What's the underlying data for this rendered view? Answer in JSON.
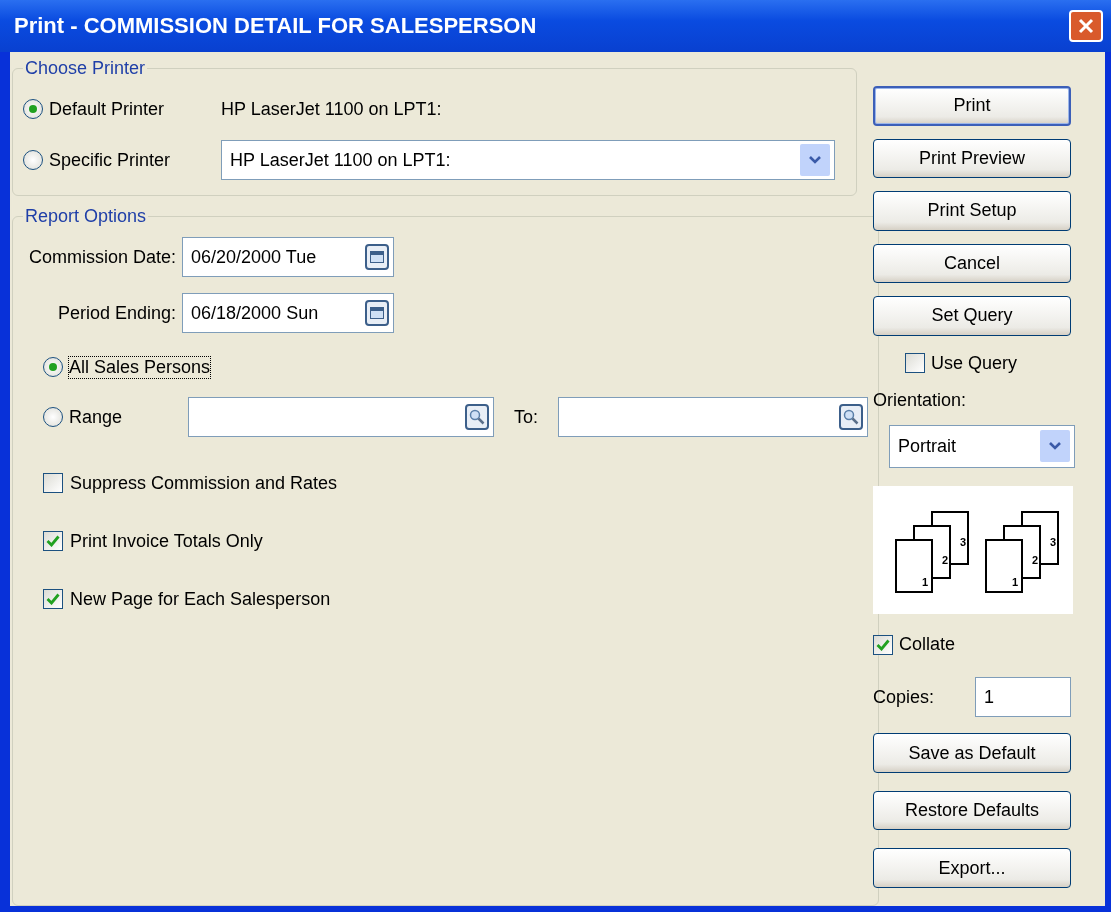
{
  "window": {
    "title": "Print - COMMISSION DETAIL FOR SALESPERSON"
  },
  "choose_printer": {
    "title": "Choose Printer",
    "options": [
      {
        "label": "Default Printer",
        "selected": true,
        "kind": "text",
        "value": "HP LaserJet 1100 on LPT1:"
      },
      {
        "label": "Specific Printer",
        "selected": false,
        "kind": "dropdown",
        "value": "HP LaserJet 1100 on LPT1:"
      }
    ]
  },
  "report_options": {
    "title": "Report Options",
    "dates": [
      {
        "label": "Commission Date:",
        "value": "06/20/2000 Tue"
      },
      {
        "label": "Period Ending:",
        "value": "06/18/2000 Sun"
      }
    ],
    "salespersons": [
      {
        "label": "All Sales Persons",
        "selected": true,
        "focused": true,
        "kind": "plain"
      },
      {
        "label": "Range",
        "selected": false,
        "focused": false,
        "kind": "range"
      }
    ],
    "range": {
      "to_label": "To:"
    },
    "checks": [
      {
        "label": "Suppress Commission and Rates",
        "checked": false
      },
      {
        "label": "Print Invoice Totals Only",
        "checked": true
      },
      {
        "label": "New Page for Each Salesperson",
        "checked": true
      }
    ]
  },
  "actions": [
    {
      "label": "Print",
      "default": true
    },
    {
      "label": "Print Preview",
      "default": false
    },
    {
      "label": "Print Setup",
      "default": false
    },
    {
      "label": "Cancel",
      "default": false
    },
    {
      "label": "Set Query",
      "default": false
    }
  ],
  "use_query": {
    "label": "Use Query",
    "checked": false
  },
  "orientation": {
    "label": "Orientation:",
    "value": "Portrait"
  },
  "collate_preview": {
    "stacks": [
      {
        "pages": [
          "1",
          "2",
          "3"
        ]
      },
      {
        "pages": [
          "1",
          "2",
          "3"
        ]
      }
    ]
  },
  "collate": {
    "label": "Collate",
    "checked": true
  },
  "copies": {
    "label": "Copies:",
    "value": "1"
  },
  "bottom_buttons": [
    {
      "label": "Save as Default"
    },
    {
      "label": "Restore Defaults"
    },
    {
      "label": "Export..."
    }
  ]
}
